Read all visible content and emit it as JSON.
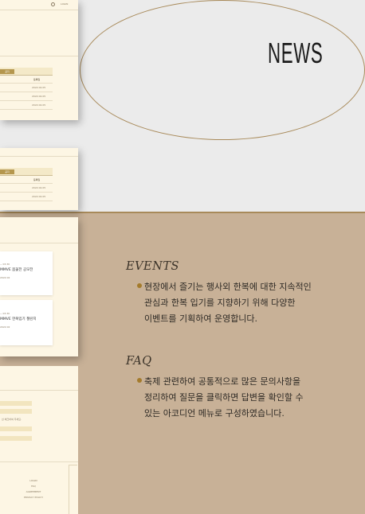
{
  "header": {
    "title": "NEWS"
  },
  "mockup": {
    "nav_label": "LOGIN",
    "notice_table": {
      "tab_label": "공지",
      "col_header": "등록일",
      "dates": [
        "2022.02.05",
        "2022.02.05",
        "2022.02.05"
      ]
    },
    "notice_table_2": {
      "tab_label": "공지",
      "col_header": "등록일",
      "dates": [
        "2022.02.05",
        "2022.02.05"
      ]
    },
    "events": [
      {
        "date": "~ 03.30",
        "title": "MMVE 봄꽃전 공모전",
        "sub": "2022.02"
      },
      {
        "date": "~ 03.30",
        "title": "MMVE 한복입기 챌린지",
        "sub": "2022.02"
      }
    ],
    "form": {
      "note": "선 체크하여 주세요."
    },
    "footer_links": [
      "LOGIN",
      "FAQ",
      "AGREEMENT",
      "PRIVACY POLICY"
    ]
  },
  "sections": {
    "events": {
      "title": "EVENTS",
      "lines": [
        "현장에서 즐기는 행사외 한복에 대한 지속적인",
        "관심과 한복 입기를 지향하기 위해 다양한",
        "이벤트를 기획하여 운영합니다."
      ]
    },
    "faq": {
      "title": "FAQ",
      "lines": [
        "축제 관련하여 공통적으로 많은 문의사항을",
        "정리하여 질문을 클릭하면 답변을 확인할 수",
        "있는 아코디언 메뉴로 구성하였습니다."
      ]
    }
  },
  "colors": {
    "accent": "#a88a5a",
    "background_bottom": "#c8b197",
    "background_top": "#ebebeb",
    "card": "#fdf6e4"
  }
}
